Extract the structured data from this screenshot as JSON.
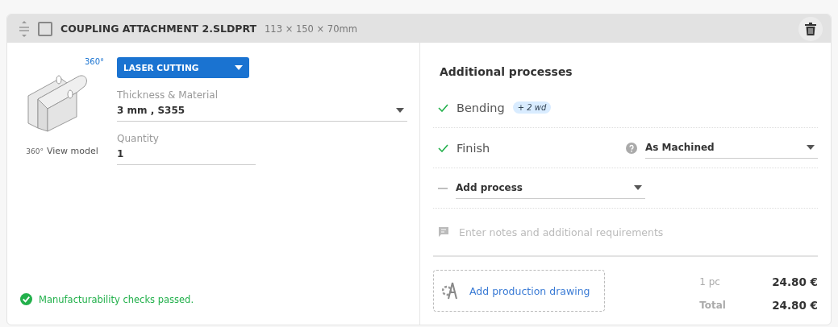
{
  "part": {
    "name": "COUPLING ATTACHMENT 2.SLDPRT",
    "dimensions": "113 × 150 × 70mm",
    "checked": false
  },
  "model": {
    "rotate_label": "360°",
    "view_label": "360°",
    "view_link": "View model"
  },
  "technology": {
    "value": "LASER CUTTING"
  },
  "material": {
    "label": "Thickness & Material",
    "value": "3 mm , S355"
  },
  "quantity": {
    "label": "Quantity",
    "value": "1"
  },
  "check": {
    "text": "Manufacturability checks passed."
  },
  "processes": {
    "title": "Additional processes",
    "items": [
      {
        "kind": "done",
        "label": "Bending",
        "badge": "+ 2 wd"
      },
      {
        "kind": "done",
        "label": "Finish",
        "select": "As Machined"
      },
      {
        "kind": "add",
        "select": "Add process"
      }
    ]
  },
  "notes": {
    "placeholder": "Enter notes and additional requirements"
  },
  "drawing": {
    "label": "Add production drawing"
  },
  "price": {
    "rows": [
      {
        "label": "1 pc",
        "value": "24.80 €"
      },
      {
        "label": "Total",
        "value": "24.80 €"
      }
    ]
  }
}
